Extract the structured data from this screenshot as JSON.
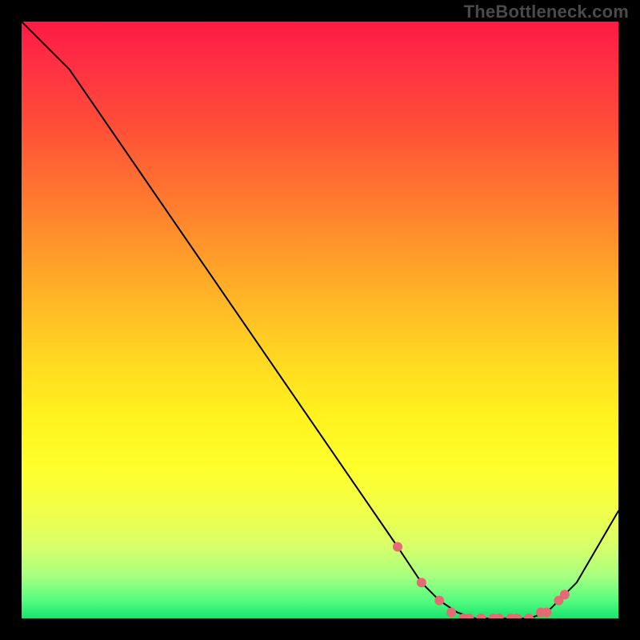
{
  "watermark": "TheBottleneck.com",
  "chart_data": {
    "type": "line",
    "title": "",
    "xlabel": "",
    "ylabel": "",
    "xlim": [
      0,
      100
    ],
    "ylim": [
      0,
      100
    ],
    "background_gradient": [
      "#fe1a44",
      "#ffd322",
      "#16e66c"
    ],
    "series": [
      {
        "name": "bottleneck-curve",
        "x": [
          0,
          8,
          63,
          67,
          70,
          73,
          76,
          79,
          82,
          85,
          88,
          93,
          100
        ],
        "values": [
          100,
          92,
          12,
          6,
          3,
          1,
          0,
          0,
          0,
          0,
          1,
          6,
          18
        ]
      }
    ],
    "markers": {
      "name": "highlight-points",
      "x": [
        63,
        67,
        70,
        72,
        74,
        75,
        77,
        79,
        80,
        82,
        83,
        85,
        87,
        88,
        90,
        91
      ],
      "values": [
        12,
        6,
        3,
        1,
        0,
        0,
        0,
        0,
        0,
        0,
        0,
        0,
        1,
        1,
        3,
        4
      ],
      "color": "#e46a73"
    }
  }
}
